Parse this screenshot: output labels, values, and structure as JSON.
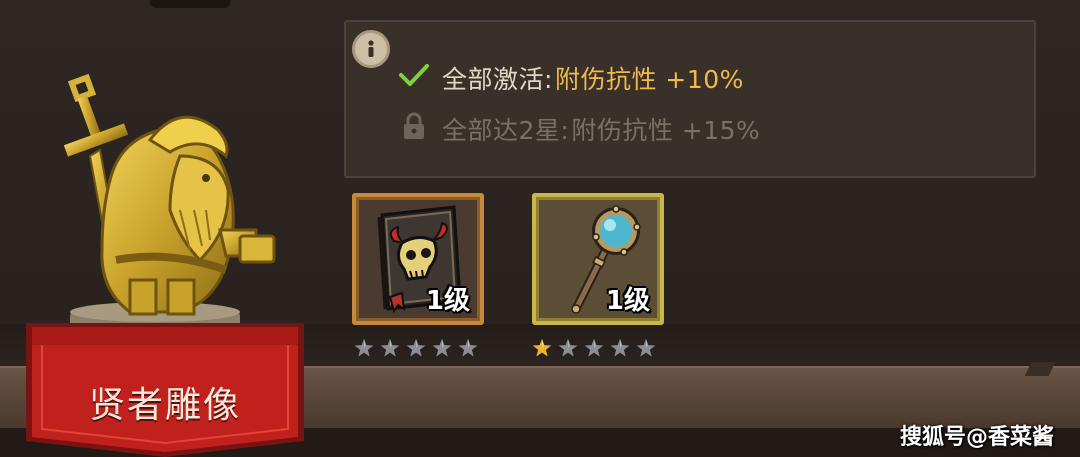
{
  "statue": {
    "name": "贤者雕像",
    "icon": "golden-statue-icon"
  },
  "bonuses": [
    {
      "status_icon": "check-icon",
      "prefix": "全部激活:",
      "value": "附伤抗性 +10%",
      "active": true
    },
    {
      "status_icon": "lock-icon",
      "prefix": "全部达2星:",
      "value": "附伤抗性 +15%",
      "active": false
    }
  ],
  "items": [
    {
      "icon": "demon-skull-book-icon",
      "level": "1级",
      "stars_filled": 0,
      "stars_total": 5,
      "frame_color": "#c88a3a"
    },
    {
      "icon": "magnifying-glass-staff-icon",
      "level": "1级",
      "stars_filled": 1,
      "stars_total": 5,
      "frame_color": "#c9b74a"
    }
  ],
  "watermark": "搜狐号@香菜酱",
  "colors": {
    "active_value": "#f0b94b",
    "inactive_text": "#7c6f64",
    "check": "#7fd13b",
    "banner": "#c0211c",
    "star_filled": "#f5b12a",
    "star_empty": "#8d8d93"
  }
}
